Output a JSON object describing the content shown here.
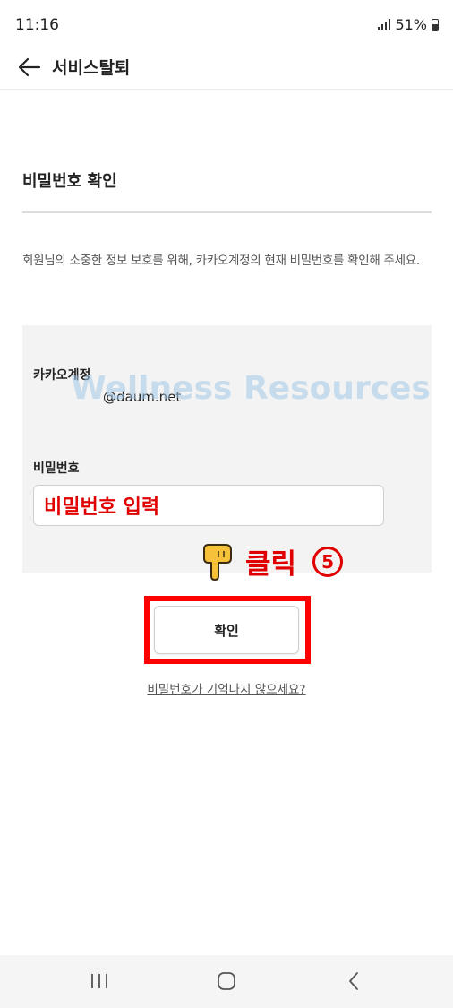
{
  "status_bar": {
    "time": "11:16",
    "battery": "51%"
  },
  "header": {
    "title": "서비스탈퇴",
    "back_icon": "arrow-left-icon"
  },
  "section": {
    "title": "비밀번호 확인",
    "description": "회원님의 소중한 정보 보호를 위해, 카카오계정의 현재 비밀번호를 확인해 주세요."
  },
  "form": {
    "account_label": "카카오계정",
    "account_value": "@daum.net",
    "watermark": "Wellness Resources",
    "password_label": "비밀번호",
    "password_value": "",
    "password_overlay": "비밀번호 입력"
  },
  "annotation": {
    "click_text": "클릭",
    "step_number": "5",
    "pointer_icon": "pointing-hand-icon"
  },
  "actions": {
    "confirm_label": "확인",
    "forgot_link": "비밀번호가 기억나지 않으세요?"
  },
  "colors": {
    "annotation_red": "#e00000",
    "highlight_red": "#ff0000",
    "panel_bg": "#f3f3f3"
  },
  "nav_bar": {
    "icons": [
      "recent-apps-icon",
      "home-icon",
      "back-icon"
    ]
  }
}
